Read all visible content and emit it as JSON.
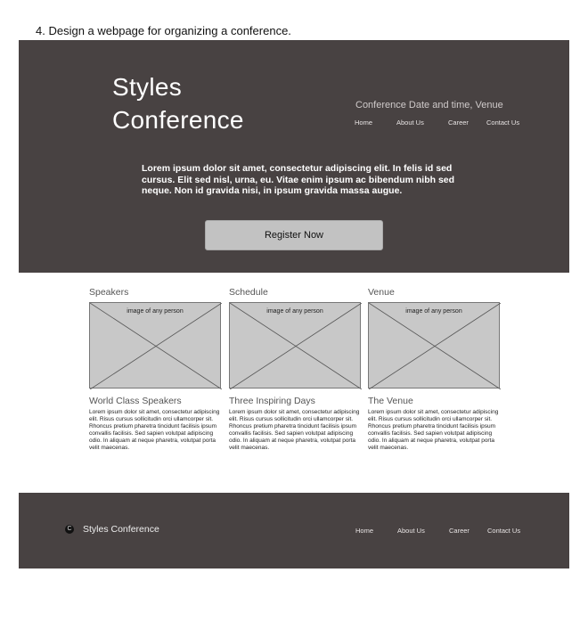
{
  "task_text": "4.  Design a webpage for organizing a conference.",
  "hero": {
    "title_line1": "Styles",
    "title_line2": "Conference",
    "subtitle": "Conference Date and time, Venue",
    "nav": [
      "Home",
      "About Us",
      "Career",
      "Contact Us"
    ],
    "intro": "Lorem ipsum dolor sit amet, consectetur adipiscing elit. In felis id sed cursus. Elit sed nisl, urna, eu. Vitae enim ipsum ac bibendum nibh sed neque. Non id gravida nisi, in ipsum gravida massa augue.",
    "register_label": "Register Now"
  },
  "cards": [
    {
      "heading": "Speakers",
      "image_label": "image of any person",
      "title": "World Class Speakers",
      "body": "Lorem ipsum dolor sit amet, consectetur adipiscing elit. Risus cursus sollicitudin orci ullamcorper sit. Rhoncus pretium pharetra tincidunt facilisis ipsum convallis facilisis. Sed sapien volutpat adipiscing odio. In aliquam at neque pharetra, volutpat porta velit maecenas."
    },
    {
      "heading": "Schedule",
      "image_label": "image of any person",
      "title": "Three Inspiring Days",
      "body": "Lorem ipsum dolor sit amet, consectetur adipiscing elit. Risus cursus sollicitudin orci ullamcorper sit. Rhoncus pretium pharetra tincidunt facilisis ipsum convallis facilisis. Sed sapien volutpat adipiscing odio. In aliquam at neque pharetra, volutpat porta velit maecenas."
    },
    {
      "heading": "Venue",
      "image_label": "image of any person",
      "title": "The Venue",
      "body": "Lorem ipsum dolor sit amet, consectetur adipiscing elit. Risus cursus sollicitudin orci ullamcorper sit. Rhoncus pretium pharetra tincidunt facilisis ipsum convallis facilisis. Sed sapien volutpat adipiscing odio. In aliquam at neque pharetra, volutpat porta velit maecenas."
    }
  ],
  "footer": {
    "logo_glyph": "C",
    "brand": "Styles Conference",
    "nav": [
      "Home",
      "About Us",
      "Career",
      "Contact Us"
    ]
  },
  "colors": {
    "hero_bg": "#484242",
    "button_bg": "#c2c2c2",
    "placeholder_bg": "#c8c8c8"
  }
}
